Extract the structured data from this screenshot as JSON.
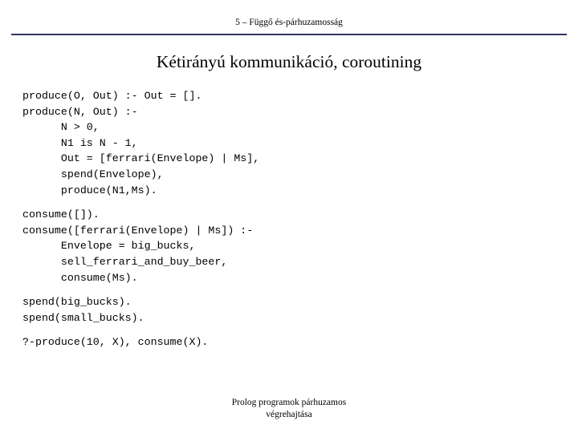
{
  "header": {
    "text": "5 – Függő és-párhuzamosság",
    "rule_color": "#333366"
  },
  "title": "Kétirányú kommunikáció, coroutining",
  "code": {
    "lines": [
      "produce(O, Out) :- Out = [].",
      "produce(N, Out) :-",
      "      N > 0,",
      "      N1 is N - 1,",
      "      Out = [ferrari(Envelope) | Ms],",
      "      spend(Envelope),",
      "      produce(N1,Ms).",
      "",
      "consume([]).",
      "consume([ferrari(Envelope) | Ms]) :-",
      "      Envelope = big_bucks,",
      "      sell_ferrari_and_buy_beer,",
      "      consume(Ms).",
      "",
      "spend(big_bucks).",
      "spend(small_bucks).",
      "",
      "?-produce(10, X), consume(X)."
    ]
  },
  "footer": {
    "line1": "Prolog programok párhuzamos",
    "line2": "végrehajtása"
  }
}
